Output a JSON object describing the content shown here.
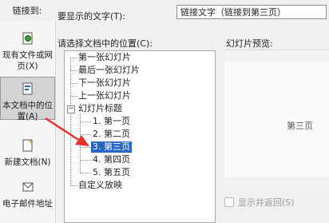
{
  "dialog": {
    "link_to_label": "链接到:",
    "display_text_label": "要显示的文字(T):",
    "display_text_value": "链接文字（链接到第三页）",
    "select_place_label": "请选择文档中的位置(C):",
    "preview_label": "幻灯片预览:",
    "preview_slide_text": "第三页",
    "show_and_return_label": "显示并返回(S)"
  },
  "nav": {
    "items": [
      {
        "label": "现有文件或网页(X)",
        "icon": "globe-document-icon"
      },
      {
        "label": "本文档中的位置(A)",
        "icon": "place-in-document-icon"
      },
      {
        "label": "新建文档(N)",
        "icon": "new-document-icon"
      },
      {
        "label": "电子邮件地址",
        "icon": "email-icon"
      }
    ]
  },
  "tree": {
    "items": [
      {
        "label": "第一张幻灯片"
      },
      {
        "label": "最后一张幻灯片"
      },
      {
        "label": "下一张幻灯片"
      },
      {
        "label": "上一张幻灯片"
      },
      {
        "label": "幻灯片标题"
      },
      {
        "label": "1. 第一页"
      },
      {
        "label": "2. 第二页"
      },
      {
        "label": "3. 第三页"
      },
      {
        "label": "4. 第四页"
      },
      {
        "label": "5. 第五页"
      },
      {
        "label": "自定义放映"
      }
    ],
    "selected_index": 7
  },
  "colors": {
    "selection": "#2a66c4",
    "arrow": "#e8322c"
  }
}
